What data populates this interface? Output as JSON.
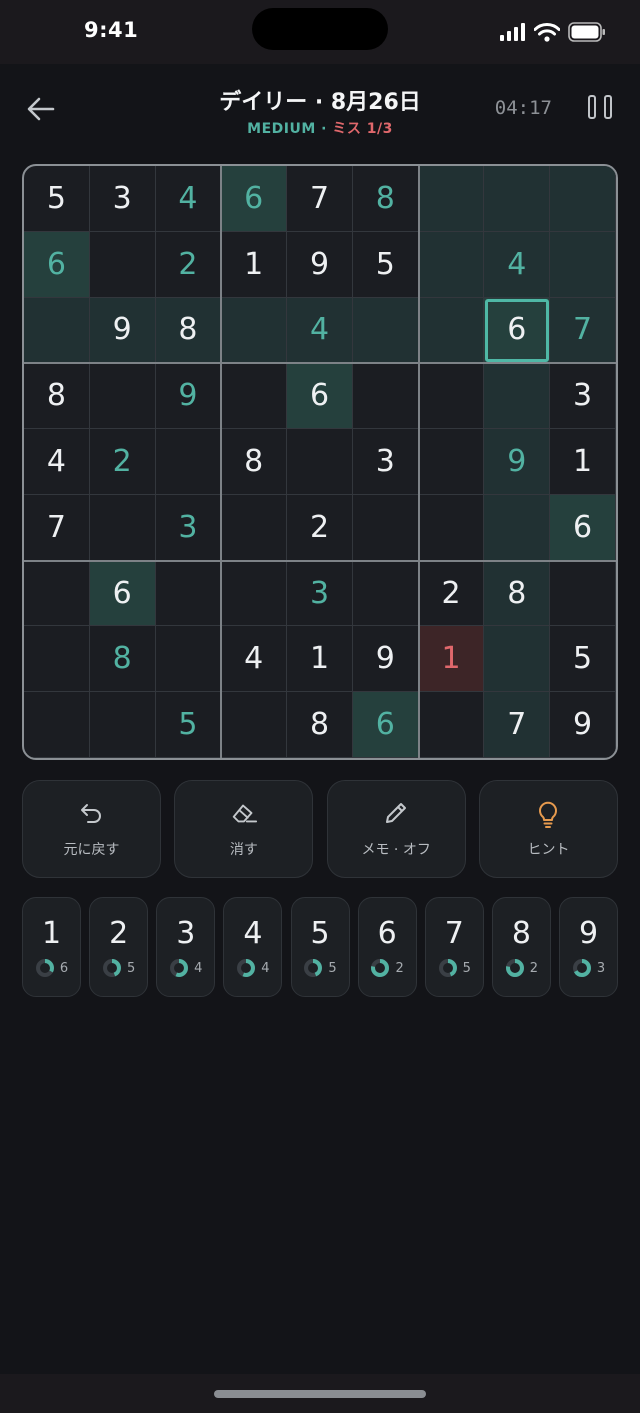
{
  "status": {
    "time": "9:41"
  },
  "header": {
    "title": "デイリー · 8月26日",
    "difficulty": "MEDIUM",
    "separator": "·",
    "mistakes": "ミス 1/3",
    "timer": "04:17"
  },
  "board": {
    "rows": [
      [
        "5",
        "3",
        "4",
        "6",
        "7",
        "8",
        "",
        "",
        ""
      ],
      [
        "6",
        "",
        "2",
        "1",
        "9",
        "5",
        "",
        "4",
        ""
      ],
      [
        "",
        "9",
        "8",
        "",
        "4",
        "",
        "",
        "6",
        "7"
      ],
      [
        "8",
        "",
        "9",
        "",
        "6",
        "",
        "",
        "",
        "3"
      ],
      [
        "4",
        "2",
        "",
        "8",
        "",
        "3",
        "",
        "9",
        "1"
      ],
      [
        "7",
        "",
        "3",
        "",
        "2",
        "",
        "",
        "",
        "6"
      ],
      [
        "",
        "6",
        "",
        "",
        "3",
        "",
        "2",
        "8",
        ""
      ],
      [
        "",
        "8",
        "",
        "4",
        "1",
        "9",
        "1",
        "",
        "5"
      ],
      [
        "",
        "",
        "5",
        "",
        "8",
        "6",
        "",
        "7",
        "9"
      ]
    ],
    "types": [
      [
        "g",
        "g",
        "u",
        "u",
        "g",
        "u",
        "",
        "",
        ""
      ],
      [
        "u",
        "",
        "u",
        "g",
        "g",
        "g",
        "",
        "u",
        ""
      ],
      [
        "",
        "g",
        "g",
        "",
        "u",
        "",
        "",
        "g",
        "u"
      ],
      [
        "g",
        "",
        "u",
        "",
        "g",
        "",
        "",
        "",
        "g"
      ],
      [
        "g",
        "u",
        "",
        "g",
        "",
        "g",
        "",
        "u",
        "g"
      ],
      [
        "g",
        "",
        "u",
        "",
        "g",
        "",
        "",
        "",
        "g"
      ],
      [
        "",
        "g",
        "",
        "",
        "u",
        "",
        "g",
        "g",
        ""
      ],
      [
        "",
        "u",
        "",
        "g",
        "g",
        "g",
        "e",
        "",
        "g"
      ],
      [
        "",
        "",
        "u",
        "",
        "g",
        "u",
        "",
        "g",
        "g"
      ]
    ],
    "selected": [
      2,
      7
    ],
    "error_cells": [
      [
        7,
        6
      ]
    ],
    "same_value": "6",
    "colors": {
      "given": "#eef0f2",
      "user": "#52b2a2",
      "error": "#e0686c",
      "accent": "#4fb8a6"
    }
  },
  "tools": [
    {
      "id": "undo",
      "label": "元に戻す",
      "icon": "undo-icon"
    },
    {
      "id": "erase",
      "label": "消す",
      "icon": "eraser-icon"
    },
    {
      "id": "notes",
      "label": "メモ · オフ",
      "icon": "pencil-icon"
    },
    {
      "id": "hint",
      "label": "ヒント",
      "icon": "lightbulb-icon"
    }
  ],
  "numpad": [
    {
      "digit": "1",
      "remaining": "6",
      "progress": 0.33
    },
    {
      "digit": "2",
      "remaining": "5",
      "progress": 0.44
    },
    {
      "digit": "3",
      "remaining": "4",
      "progress": 0.56
    },
    {
      "digit": "4",
      "remaining": "4",
      "progress": 0.56
    },
    {
      "digit": "5",
      "remaining": "5",
      "progress": 0.44
    },
    {
      "digit": "6",
      "remaining": "2",
      "progress": 0.78
    },
    {
      "digit": "7",
      "remaining": "5",
      "progress": 0.44
    },
    {
      "digit": "8",
      "remaining": "2",
      "progress": 0.78
    },
    {
      "digit": "9",
      "remaining": "3",
      "progress": 0.67
    }
  ]
}
